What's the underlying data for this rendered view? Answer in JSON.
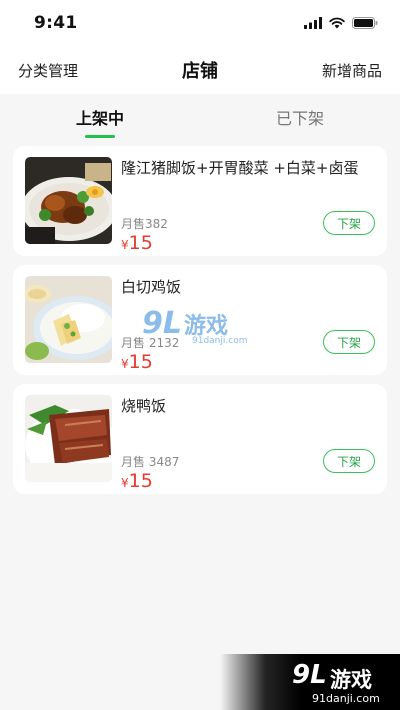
{
  "status_bar": {
    "time": "9:41"
  },
  "nav": {
    "left": "分类管理",
    "title": "店铺",
    "right": "新增商品"
  },
  "tabs": [
    {
      "label": "上架中",
      "active": true
    },
    {
      "label": "已下架",
      "active": false
    }
  ],
  "products": [
    {
      "name": "隆江猪脚饭+开胃酸菜 +白菜+卤蛋",
      "sales": "月售382",
      "currency": "¥",
      "price": "15",
      "action": "下架"
    },
    {
      "name": "白切鸡饭",
      "sales": "月售 2132",
      "currency": "¥",
      "price": "15",
      "action": "下架"
    },
    {
      "name": "烧鸭饭",
      "sales": "月售 3487",
      "currency": "¥",
      "price": "15",
      "action": "下架"
    }
  ],
  "watermark": {
    "logo": "9L",
    "text": "游戏",
    "url": "91danji.com"
  },
  "colors": {
    "accent": "#21c14d",
    "price": "#e83a2f",
    "button_border": "#3cc05b"
  }
}
